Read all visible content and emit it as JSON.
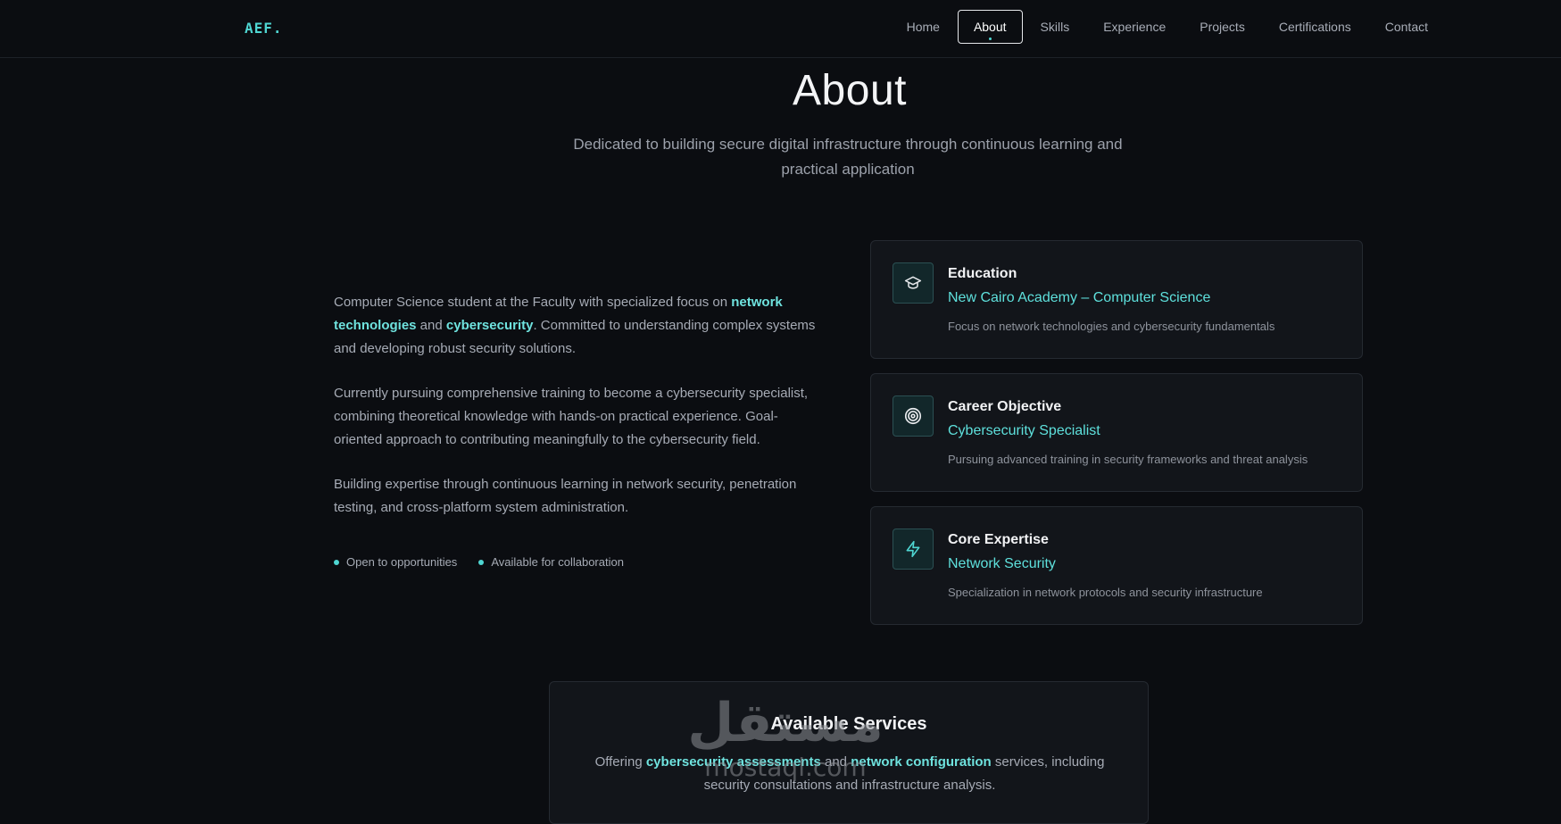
{
  "nav": {
    "logo": "AEF.",
    "links": [
      "Home",
      "About",
      "Skills",
      "Experience",
      "Projects",
      "Certifications",
      "Contact"
    ],
    "active": "About"
  },
  "hero": {
    "title": "About",
    "subtitle": "Dedicated to building secure digital infrastructure through continuous learning and practical application"
  },
  "about": {
    "p1_a": "Computer Science student at the Faculty with specialized focus on ",
    "p1_hl1": "network technologies",
    "p1_b": " and ",
    "p1_hl2": "cybersecurity",
    "p1_c": ". Committed to understanding complex systems and developing robust security solutions.",
    "p2": "Currently pursuing comprehensive training to become a cybersecurity specialist, combining theoretical knowledge with hands-on practical experience. Goal-oriented approach to contributing meaningfully to the cybersecurity field.",
    "p3": "Building expertise through continuous learning in network security, penetration testing, and cross-platform system administration.",
    "status": [
      "Open to opportunities",
      "Available for collaboration"
    ]
  },
  "cards": [
    {
      "title": "Education",
      "subtitle": "New Cairo Academy – Computer Science",
      "desc": "Focus on network technologies and cybersecurity fundamentals",
      "icon": "graduation-cap-icon"
    },
    {
      "title": "Career Objective",
      "subtitle": "Cybersecurity Specialist",
      "desc": "Pursuing advanced training in security frameworks and threat analysis",
      "icon": "target-icon"
    },
    {
      "title": "Core Expertise",
      "subtitle": "Network Security",
      "desc": "Specialization in network protocols and security infrastructure",
      "icon": "lightning-icon"
    }
  ],
  "services": {
    "title": "Available Services",
    "text_a": "Offering ",
    "hl1": "cybersecurity assessments",
    "text_b": " and ",
    "hl2": "network configuration",
    "text_c": " services, including security consultations and infrastructure analysis."
  },
  "watermark": {
    "arabic": "مستقل",
    "latin": "mostaql.com"
  },
  "colors": {
    "accent": "#4fd6d2",
    "background": "#0b0d11",
    "card": "#12151a"
  }
}
